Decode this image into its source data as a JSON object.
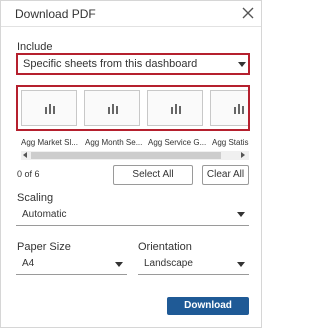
{
  "dialog": {
    "title": "Download PDF",
    "close_icon": "close-icon"
  },
  "include": {
    "label": "Include",
    "selected": "Specific sheets from this dashboard"
  },
  "sheets": [
    {
      "label": "Agg Market Sl...",
      "icon": "bar-chart-icon"
    },
    {
      "label": "Agg Month Se...",
      "icon": "bar-chart-icon"
    },
    {
      "label": "Agg Service G...",
      "icon": "bar-chart-icon"
    },
    {
      "label": "Agg Statis",
      "icon": "bar-chart-icon"
    }
  ],
  "selection": {
    "count": "0 of 6",
    "select_all": "Select All",
    "clear_all": "Clear All"
  },
  "scaling": {
    "label": "Scaling",
    "selected": "Automatic"
  },
  "paper_size": {
    "label": "Paper Size",
    "selected": "A4"
  },
  "orientation": {
    "label": "Orientation",
    "selected": "Landscape"
  },
  "download_button": "Download",
  "colors": {
    "highlight_outline": "#b5202e",
    "primary_button": "#1f5a96"
  }
}
